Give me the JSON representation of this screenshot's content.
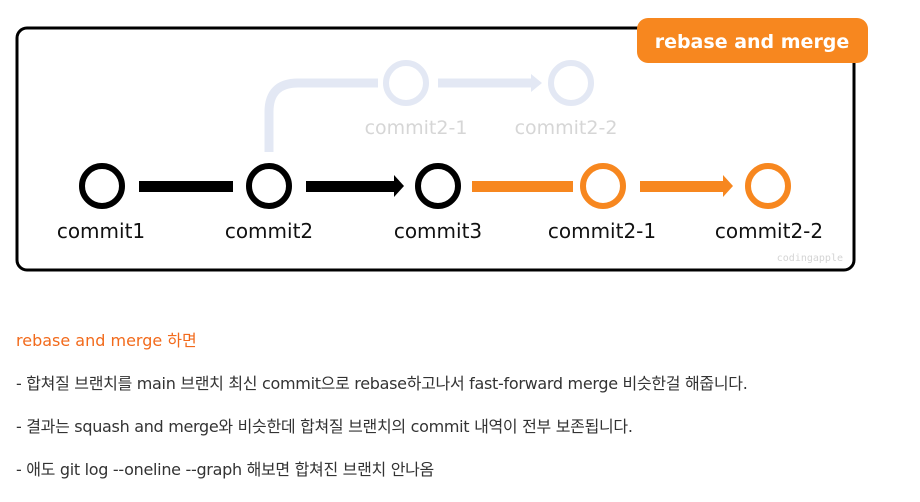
{
  "diagram": {
    "badge": "rebase and merge",
    "main_commits": [
      "commit1",
      "commit2",
      "commit3",
      "commit2-1",
      "commit2-2"
    ],
    "faded_commits": [
      "commit2-1",
      "commit2-2"
    ],
    "watermark": "codingapple",
    "colors": {
      "accent": "#f7871f",
      "main": "#000000",
      "faded": "#e3e8f4"
    }
  },
  "notes": {
    "heading": "rebase and merge 하면",
    "bullets": [
      "- 합쳐질 브랜치를 main 브랜치 최신 commit으로 rebase하고나서 fast-forward merge 비슷한걸 해줍니다.",
      "- 결과는 squash and merge와 비슷한데 합쳐질 브랜치의 commit 내역이 전부 보존됩니다.",
      "- 애도 git log --oneline --graph 해보면 합쳐진 브랜치 안나옴"
    ]
  }
}
